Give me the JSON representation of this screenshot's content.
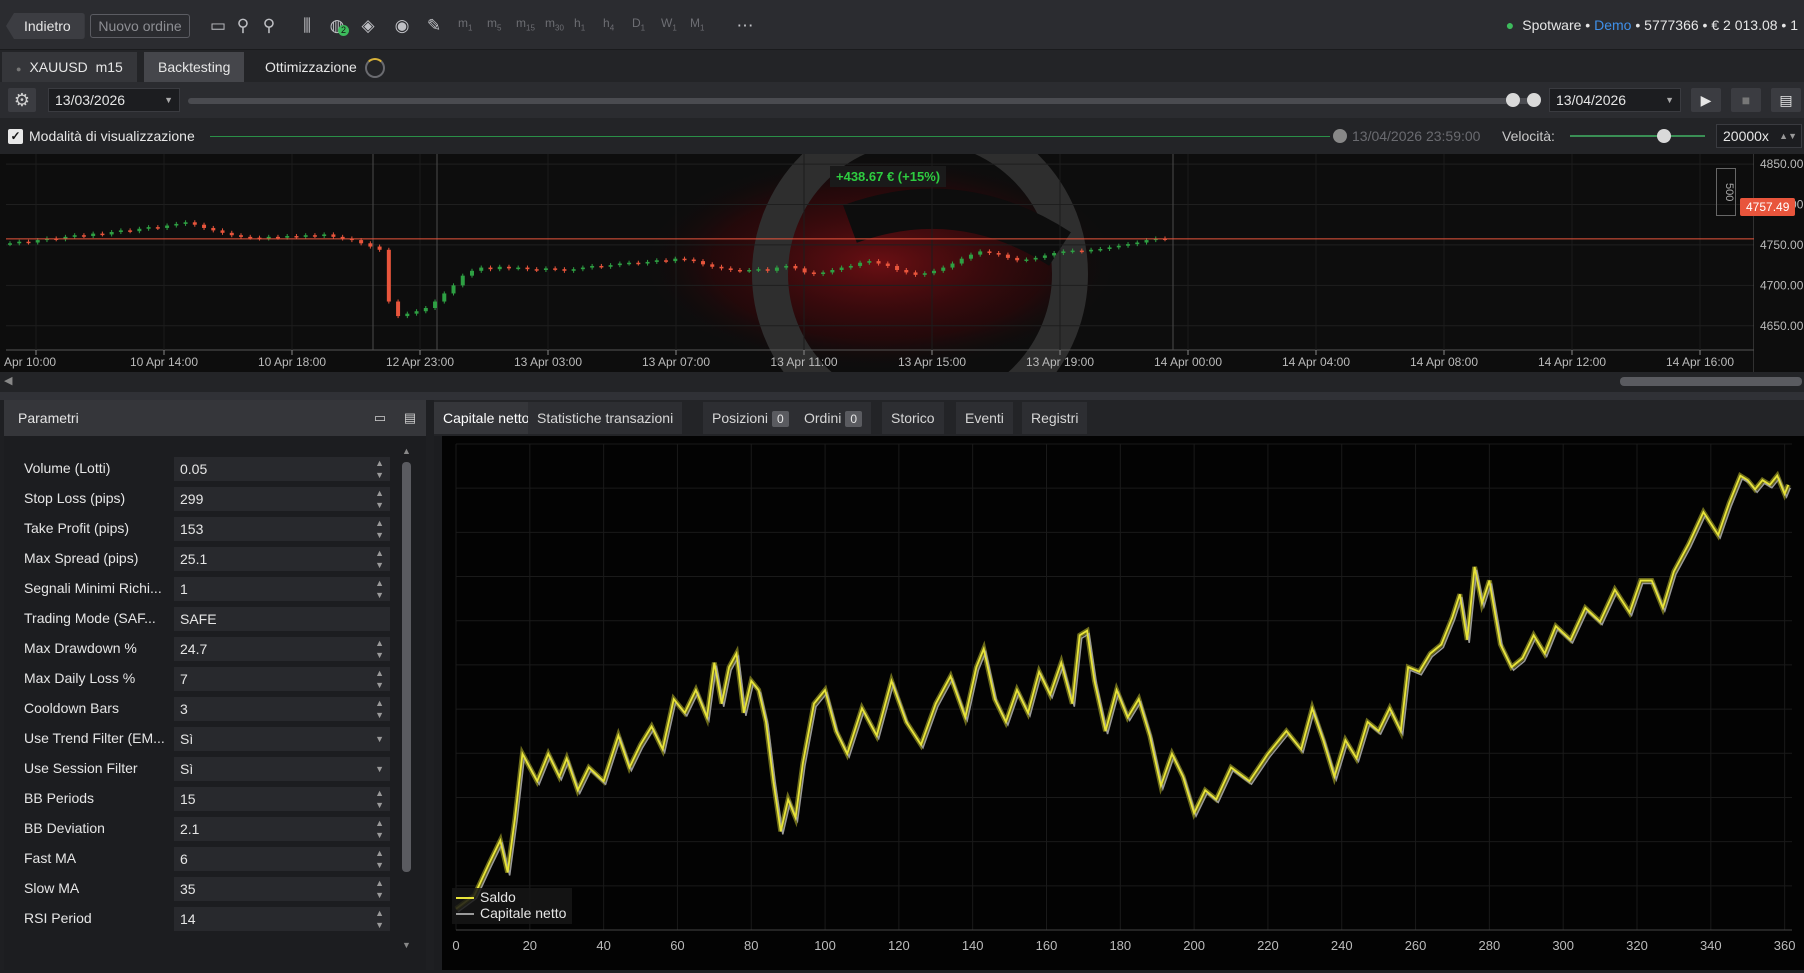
{
  "topbar": {
    "back_label": "Indietro",
    "new_order_label": "Nuovo ordine",
    "timeframes": [
      {
        "main": "m",
        "sub": "1"
      },
      {
        "main": "m",
        "sub": "5"
      },
      {
        "main": "m",
        "sub": "15"
      },
      {
        "main": "m",
        "sub": "30"
      },
      {
        "main": "h",
        "sub": "1"
      },
      {
        "main": "h",
        "sub": "4"
      },
      {
        "main": "D",
        "sub": "1"
      },
      {
        "main": "W",
        "sub": "1"
      },
      {
        "main": "M",
        "sub": "1"
      }
    ],
    "alert_count": "2",
    "account": {
      "broker": "Spotware",
      "type": "Demo",
      "number": "5777366",
      "balance": "€ 2 013.08 • 1"
    }
  },
  "tabs": {
    "symbol": "XAUUSD",
    "timeframe": "m15",
    "backtesting": "Backtesting",
    "optimization": "Ottimizzazione"
  },
  "dates": {
    "start": "13/03/2026",
    "end": "13/04/2026"
  },
  "mode": {
    "visual_mode_label": "Modalità di visualizzazione",
    "visual_mode_checked": true,
    "current_time": "13/04/2026 23:59:00",
    "speed_label": "Velocità:",
    "speed_value": "20000x"
  },
  "price_chart": {
    "pnl_label": "+438.67 € (+15%)",
    "current_price": "4757.49",
    "y_ticks": [
      "4850.00",
      "4800.00",
      "4750.00",
      "4700.00",
      "4650.00"
    ],
    "x_ticks": [
      "Apr 10:00",
      "10 Apr 14:00",
      "10 Apr 18:00",
      "12 Apr 23:00",
      "13 Apr 03:00",
      "13 Apr 07:00",
      "13 Apr 11:00",
      "13 Apr 15:00",
      "13 Apr 19:00",
      "14 Apr 00:00",
      "14 Apr 04:00",
      "14 Apr 08:00",
      "14 Apr 12:00",
      "14 Apr 16:00"
    ],
    "scale_label": "500",
    "candle_closes": [
      4752,
      4754,
      4753,
      4756,
      4758,
      4757,
      4760,
      4762,
      4761,
      4764,
      4763,
      4766,
      4768,
      4767,
      4770,
      4772,
      4771,
      4774,
      4776,
      4778,
      4775,
      4771,
      4768,
      4765,
      4762,
      4760,
      4759,
      4758,
      4760,
      4759,
      4761,
      4760,
      4762,
      4761,
      4763,
      4760,
      4758,
      4756,
      4752,
      4748,
      4744,
      4680,
      4662,
      4665,
      4668,
      4672,
      4680,
      4690,
      4700,
      4712,
      4718,
      4722,
      4720,
      4723,
      4721,
      4722,
      4720,
      4719,
      4721,
      4720,
      4718,
      4720,
      4722,
      4724,
      4723,
      4725,
      4727,
      4728,
      4727,
      4729,
      4731,
      4730,
      4733,
      4732,
      4730,
      4726,
      4723,
      4721,
      4719,
      4718,
      4719,
      4720,
      4718,
      4722,
      4724,
      4721,
      4716,
      4714,
      4716,
      4719,
      4722,
      4724,
      4728,
      4730,
      4727,
      4724,
      4719,
      4716,
      4713,
      4715,
      4718,
      4722,
      4727,
      4733,
      4738,
      4742,
      4740,
      4738,
      4734,
      4731,
      4732,
      4734,
      4737,
      4740,
      4742,
      4743,
      4742,
      4744,
      4745,
      4747,
      4749,
      4751,
      4753,
      4756,
      4758,
      4757
    ]
  },
  "params_panel": {
    "title": "Parametri",
    "rows": [
      {
        "label": "Volume (Lotti)",
        "value": "0.05",
        "kind": "spin"
      },
      {
        "label": "Stop Loss (pips)",
        "value": "299",
        "kind": "spin"
      },
      {
        "label": "Take Profit (pips)",
        "value": "153",
        "kind": "spin"
      },
      {
        "label": "Max Spread (pips)",
        "value": "25.1",
        "kind": "spin"
      },
      {
        "label": "Segnali Minimi Richi...",
        "value": "1",
        "kind": "spin"
      },
      {
        "label": "Trading Mode (SAF...",
        "value": "SAFE",
        "kind": "text"
      },
      {
        "label": "Max Drawdown %",
        "value": "24.7",
        "kind": "spin"
      },
      {
        "label": "Max Daily Loss %",
        "value": "7",
        "kind": "spin"
      },
      {
        "label": "Cooldown Bars",
        "value": "3",
        "kind": "spin"
      },
      {
        "label": "Use Trend Filter (EM...",
        "value": "Sì",
        "kind": "select"
      },
      {
        "label": "Use Session Filter",
        "value": "Sì",
        "kind": "select"
      },
      {
        "label": "BB Periods",
        "value": "15",
        "kind": "spin"
      },
      {
        "label": "BB Deviation",
        "value": "2.1",
        "kind": "spin"
      },
      {
        "label": "Fast MA",
        "value": "6",
        "kind": "spin"
      },
      {
        "label": "Slow MA",
        "value": "35",
        "kind": "spin"
      },
      {
        "label": "RSI Period",
        "value": "14",
        "kind": "spin"
      }
    ]
  },
  "results_tabs": [
    {
      "label": "Capitale netto",
      "badge": null,
      "active": true
    },
    {
      "label": "Statistiche transazioni",
      "badge": null,
      "active": false
    },
    {
      "label": "Posizioni",
      "badge": "0",
      "active": false
    },
    {
      "label": "Ordini",
      "badge": "0",
      "active": false
    },
    {
      "label": "Storico",
      "badge": null,
      "active": false
    },
    {
      "label": "Eventi",
      "badge": null,
      "active": false
    },
    {
      "label": "Registri",
      "badge": null,
      "active": false
    }
  ],
  "chart_data": {
    "type": "line",
    "xlim": [
      0,
      362
    ],
    "x_ticks": [
      "0",
      "20",
      "40",
      "60",
      "80",
      "100",
      "120",
      "140",
      "160",
      "180",
      "200",
      "220",
      "240",
      "260",
      "280",
      "300",
      "320",
      "340",
      "360"
    ],
    "grid": true,
    "legend_position": "bottom-left",
    "colors": {
      "saldo": "#e8e43a",
      "capitale": "#9a9a9a"
    },
    "series": [
      {
        "name": "Saldo",
        "x": [
          0,
          5,
          9,
          12,
          14,
          16,
          18,
          20,
          22,
          25,
          28,
          30,
          33,
          36,
          40,
          44,
          47,
          50,
          53,
          56,
          59,
          62,
          65,
          68,
          70,
          72,
          74,
          76,
          78,
          80,
          82,
          84,
          86,
          88,
          90,
          92,
          94,
          97,
          100,
          103,
          106,
          110,
          114,
          118,
          122,
          126,
          130,
          134,
          138,
          141,
          143,
          146,
          149,
          152,
          155,
          158,
          161,
          164,
          167,
          169,
          171,
          173,
          176,
          179,
          182,
          185,
          188,
          191,
          194,
          197,
          200,
          203,
          206,
          210,
          215,
          220,
          225,
          229,
          232,
          235,
          238,
          241,
          244,
          247,
          250,
          253,
          256,
          258,
          261,
          264,
          267,
          270,
          272,
          274,
          276,
          278,
          280,
          283,
          286,
          289,
          292,
          295,
          298,
          302,
          306,
          310,
          314,
          318,
          321,
          324,
          327,
          330,
          334,
          338,
          342,
          345,
          348,
          350,
          352,
          354,
          356,
          358,
          360,
          361
        ]
      },
      {
        "name": "Capitale netto"
      }
    ],
    "y_values": [
      0.02,
      0.05,
      0.12,
      0.17,
      0.1,
      0.22,
      0.36,
      0.33,
      0.3,
      0.36,
      0.31,
      0.35,
      0.28,
      0.33,
      0.3,
      0.4,
      0.33,
      0.38,
      0.42,
      0.37,
      0.48,
      0.45,
      0.5,
      0.44,
      0.56,
      0.47,
      0.55,
      0.58,
      0.45,
      0.52,
      0.5,
      0.43,
      0.3,
      0.19,
      0.26,
      0.22,
      0.34,
      0.47,
      0.5,
      0.41,
      0.36,
      0.46,
      0.4,
      0.52,
      0.43,
      0.38,
      0.47,
      0.53,
      0.44,
      0.55,
      0.59,
      0.48,
      0.43,
      0.5,
      0.45,
      0.54,
      0.49,
      0.56,
      0.47,
      0.62,
      0.63,
      0.52,
      0.41,
      0.5,
      0.44,
      0.48,
      0.4,
      0.29,
      0.36,
      0.31,
      0.23,
      0.28,
      0.26,
      0.33,
      0.3,
      0.36,
      0.41,
      0.37,
      0.46,
      0.39,
      0.31,
      0.39,
      0.35,
      0.43,
      0.41,
      0.46,
      0.41,
      0.55,
      0.54,
      0.58,
      0.6,
      0.66,
      0.71,
      0.61,
      0.77,
      0.69,
      0.74,
      0.6,
      0.55,
      0.57,
      0.62,
      0.58,
      0.64,
      0.61,
      0.68,
      0.65,
      0.72,
      0.67,
      0.74,
      0.74,
      0.68,
      0.76,
      0.82,
      0.89,
      0.84,
      0.91,
      0.97,
      0.96,
      0.94,
      0.96,
      0.95,
      0.97,
      0.93,
      0.95
    ]
  }
}
